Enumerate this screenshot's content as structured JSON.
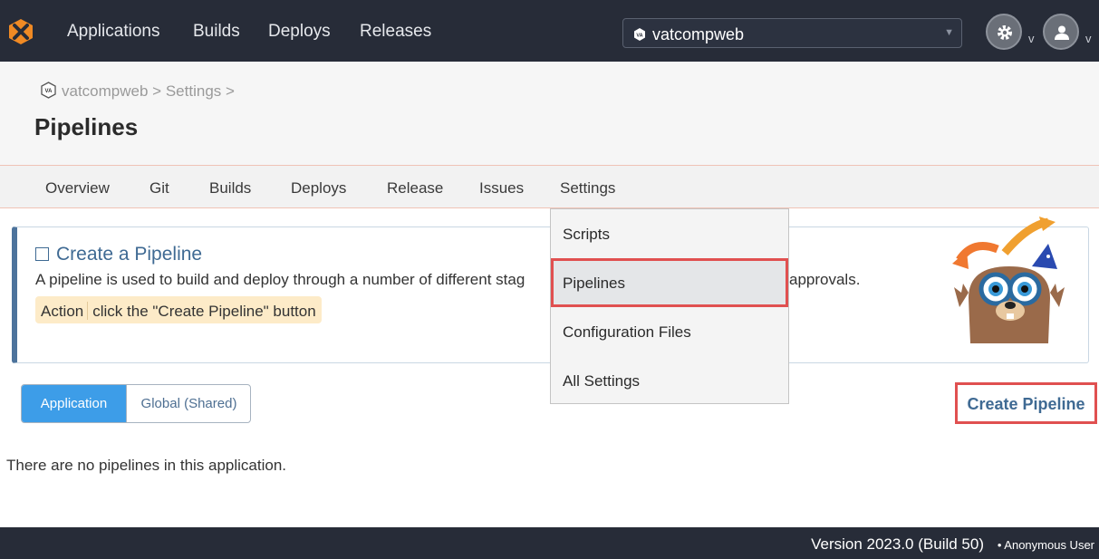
{
  "nav": {
    "links": [
      "Applications",
      "Builds",
      "Deploys",
      "Releases"
    ],
    "app_selector": "vatcompweb",
    "badge_text": "VA"
  },
  "breadcrumb": {
    "app": "vatcompweb",
    "sep1": ">",
    "settings": "Settings",
    "sep2": ">"
  },
  "page_title": "Pipelines",
  "tabs": [
    "Overview",
    "Git",
    "Builds",
    "Deploys",
    "Release",
    "Issues",
    "Settings"
  ],
  "info": {
    "title": "Create a Pipeline",
    "text_start": "A pipeline is used to build and deploy through a number of different stag",
    "text_end": "approvals.",
    "action_label": "Action",
    "action_text": "click the \"Create Pipeline\" button"
  },
  "dropdown": [
    "Scripts",
    "Pipelines",
    "Configuration Files",
    "All Settings"
  ],
  "toggle": {
    "application": "Application",
    "global": "Global (Shared)"
  },
  "create_button": "Create Pipeline",
  "empty_text": "There are no pipelines in this application.",
  "footer": {
    "version": "Version 2023.0 (Build 50)",
    "user": "• Anonymous User"
  },
  "colors": {
    "navbar": "#272c38",
    "accent": "#3d9de8",
    "highlight": "#e05050",
    "link": "#3f6a93"
  }
}
